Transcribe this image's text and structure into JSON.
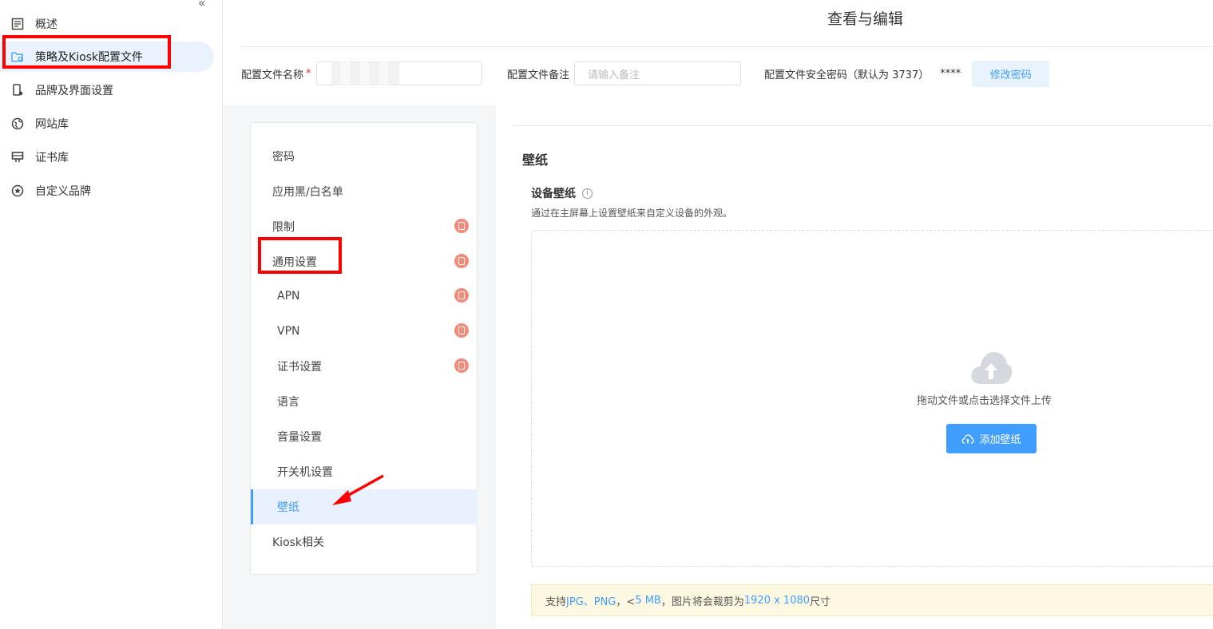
{
  "nav": {
    "collapse": "«",
    "items": [
      {
        "label": "概述",
        "icon": "document-icon"
      },
      {
        "label": "策略及Kiosk配置文件",
        "icon": "folder-settings-icon"
      },
      {
        "label": "品牌及界面设置",
        "icon": "phone-settings-icon"
      },
      {
        "label": "网站库",
        "icon": "globe-icon"
      },
      {
        "label": "证书库",
        "icon": "certificate-icon"
      },
      {
        "label": "自定义品牌",
        "icon": "star-circle-icon"
      }
    ]
  },
  "header": {
    "title": "查看与编辑",
    "name_label": "配置文件名称",
    "required_mark": "*",
    "name_value": "",
    "remark_label": "配置文件备注",
    "remark_placeholder": "请输入备注",
    "password_label": "配置文件安全密码（默认为 3737）",
    "password_value": "****",
    "change_password": "修改密码"
  },
  "menu": {
    "items": [
      {
        "label": "密码",
        "badge": false
      },
      {
        "label": "应用黑/白名单",
        "badge": false
      },
      {
        "label": "限制",
        "badge": true
      },
      {
        "label": "通用设置",
        "badge": true
      },
      {
        "label": "APN",
        "badge": true
      },
      {
        "label": "VPN",
        "badge": true
      },
      {
        "label": "证书设置",
        "badge": true
      },
      {
        "label": "语言",
        "badge": false
      },
      {
        "label": "音量设置",
        "badge": false
      },
      {
        "label": "开关机设置",
        "badge": false
      },
      {
        "label": "壁纸",
        "badge": false,
        "selected": true
      },
      {
        "label": "Kiosk相关",
        "badge": false
      }
    ]
  },
  "content": {
    "section_title": "壁纸",
    "field_title": "设备壁纸",
    "info": "i",
    "field_desc": "通过在主屏幕上设置壁纸来自定义设备的外观。",
    "drop_text": "拖动文件或点击选择文件上传",
    "add_button": "添加壁纸",
    "notice_1": "支持 ",
    "notice_formats": "JPG、PNG",
    "notice_2": "，< ",
    "notice_size": "5 MB",
    "notice_3": "，图片将会裁剪为 ",
    "notice_res": "1920 x 1080",
    "notice_4": " 尺寸"
  },
  "colors": {
    "accent": "#409eff",
    "annotation": "#ff0000"
  }
}
